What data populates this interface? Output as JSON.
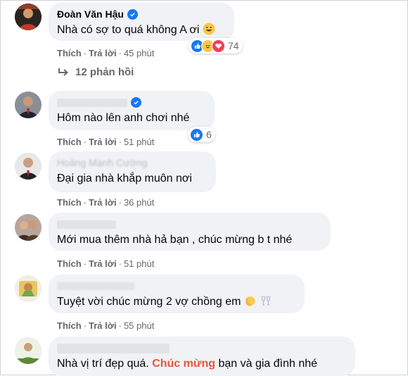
{
  "actions": {
    "like": "Thích",
    "reply": "Trả lời",
    "sep": "·"
  },
  "comments": [
    {
      "name": "Đoàn Văn Hậu",
      "verified": true,
      "text": "Nhà có sợ to quá không A ơi",
      "emoji": "grinning-face",
      "time": "45 phút",
      "reaction_count": "74",
      "reaction_icons": [
        "like-icon",
        "haha-icon",
        "love-icon"
      ]
    },
    {
      "name": "",
      "verified": true,
      "text": "Hôm nào lên anh chơi nhé",
      "time": "51 phút",
      "reaction_count": "6",
      "reaction_icons": [
        "like-icon"
      ]
    },
    {
      "name": "Hoàng Mạnh Cường",
      "verified": false,
      "text": "Đại gia nhà khắp muôn nơi",
      "time": "36 phút"
    },
    {
      "name": "",
      "verified": false,
      "text": "Mới mua thêm nhà hả bạn , chúc mừng b t nhé",
      "time": "51 phút"
    },
    {
      "name": "",
      "verified": false,
      "text": "Tuyệt vời chúc mừng 2 vợ chồng em",
      "emojis": [
        "clapping-hands",
        "clinking-glasses"
      ],
      "time": "55 phút"
    },
    {
      "name": "",
      "verified": false,
      "text_before": "Nhà vị trí đẹp quá.",
      "text_highlight": "Chúc mừng",
      "text_after": "bạn và gia đình nhé"
    }
  ],
  "replies_label": "12 phản hồi",
  "colors": {
    "bubble": "#f0f2f5",
    "meta": "#65676b",
    "verified": "#1877f2",
    "highlight": "#e4573d"
  }
}
